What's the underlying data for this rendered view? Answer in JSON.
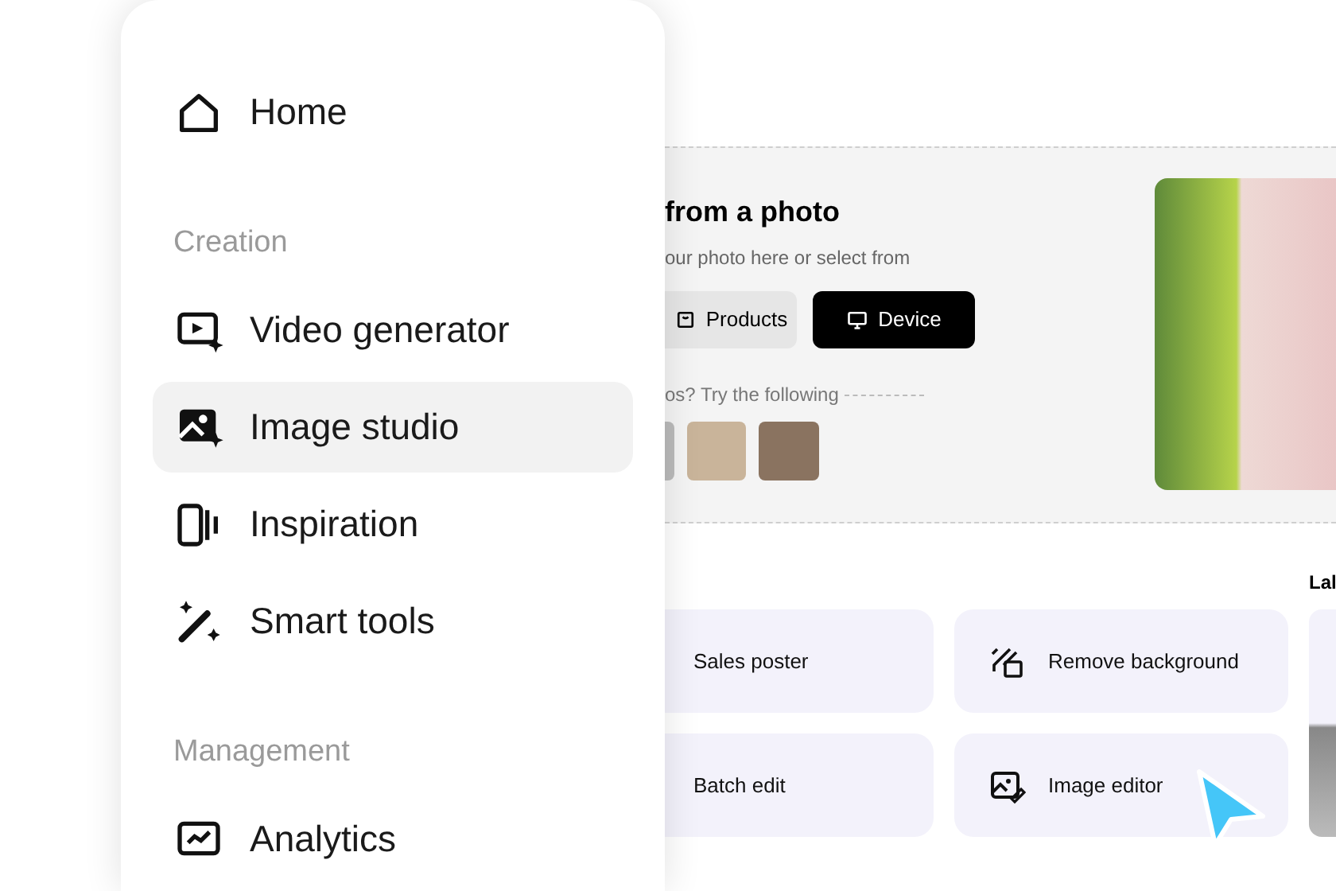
{
  "menu": {
    "items": [
      {
        "kind": "item",
        "label": "Home",
        "selected": false
      },
      {
        "kind": "section",
        "label": "Creation"
      },
      {
        "kind": "item",
        "label": "Video generator",
        "selected": false
      },
      {
        "kind": "item",
        "label": "Image studio",
        "selected": true
      },
      {
        "kind": "item",
        "label": "Inspiration",
        "selected": false
      },
      {
        "kind": "item",
        "label": "Smart tools",
        "selected": false
      },
      {
        "kind": "section",
        "label": "Management"
      },
      {
        "kind": "item",
        "label": "Analytics",
        "selected": false
      }
    ]
  },
  "upload": {
    "title": "from a photo",
    "subtitle": "our photo here or select from",
    "buttons": [
      {
        "label": "Products",
        "kind": "secondary"
      },
      {
        "label": "Device",
        "kind": "primary"
      }
    ],
    "hint": "os? Try the following"
  },
  "side_heading": "Lal",
  "tools": [
    {
      "label": "Sales poster"
    },
    {
      "label": "Remove background"
    },
    {
      "label": "Batch edit"
    },
    {
      "label": "Image editor"
    }
  ]
}
